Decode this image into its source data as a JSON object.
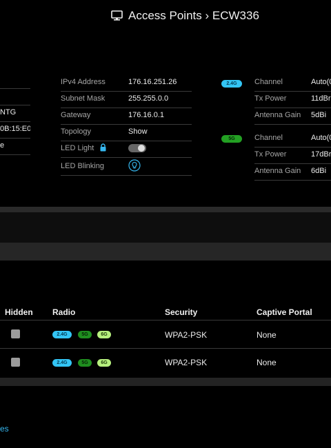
{
  "header": {
    "title": "Access Points › ECW336",
    "icon": "monitor-icon"
  },
  "left_edge": {
    "values": [
      "",
      "",
      "NTG",
      "0B:15:E0",
      "e"
    ]
  },
  "network": {
    "rows": [
      {
        "label": "IPv4 Address",
        "value": "176.16.251.26"
      },
      {
        "label": "Subnet Mask",
        "value": "255.255.0.0"
      },
      {
        "label": "Gateway",
        "value": "176.16.0.1"
      },
      {
        "label": "Topology",
        "value": "Show"
      },
      {
        "label": "LED Light",
        "value": ""
      },
      {
        "label": "LED Blinking",
        "value": ""
      }
    ],
    "led_light_on": true
  },
  "radio_24": {
    "badge": "2.4G",
    "rows": [
      {
        "label": "Channel",
        "value": "Auto(0"
      },
      {
        "label": "Tx Power",
        "value": "11dBr"
      },
      {
        "label": "Antenna Gain",
        "value": "5dBi"
      }
    ]
  },
  "radio_5": {
    "badge": "5G",
    "rows": [
      {
        "label": "Channel",
        "value": "Auto(0"
      },
      {
        "label": "Tx Power",
        "value": "17dBr"
      },
      {
        "label": "Antenna Gain",
        "value": "6dBi"
      }
    ]
  },
  "ssid_table": {
    "columns": {
      "hidden": "Hidden",
      "radio": "Radio",
      "security": "Security",
      "captive": "Captive Portal"
    },
    "rows": [
      {
        "hidden": false,
        "radios": [
          "2.4G",
          "5G",
          "6G"
        ],
        "security": "WPA2-PSK",
        "captive": "None"
      },
      {
        "hidden": false,
        "radios": [
          "2.4G",
          "5G",
          "6G"
        ],
        "security": "WPA2-PSK",
        "captive": "None"
      }
    ]
  },
  "footer": {
    "link": "es"
  },
  "colors": {
    "accent": "#36b8f0",
    "band_24": "#33c5f5",
    "band_5": "#23a023",
    "band_6": "#b6f07e",
    "background": "#000000"
  }
}
